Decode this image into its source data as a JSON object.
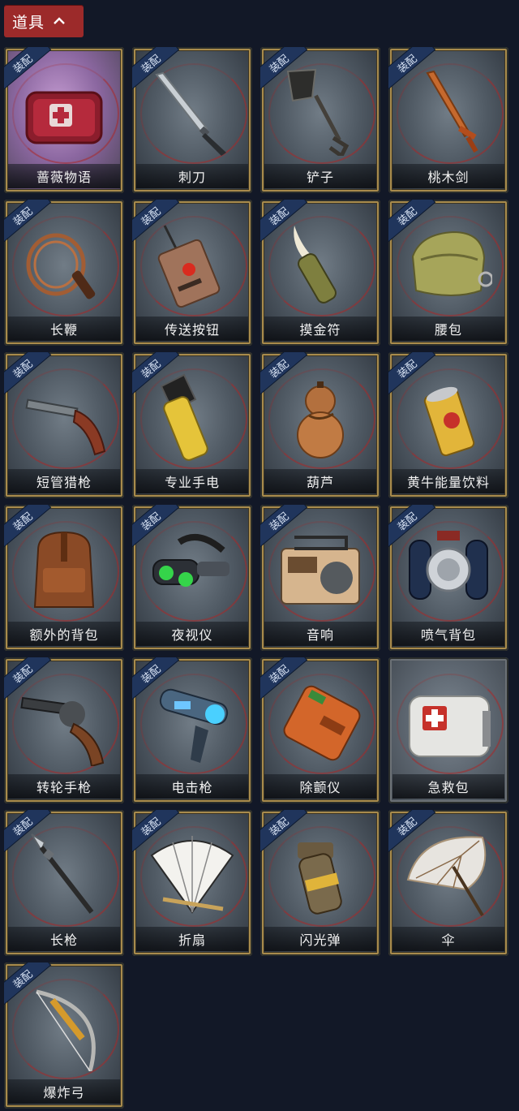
{
  "header": {
    "label": "道具"
  },
  "equip_badge": "装配",
  "items": [
    {
      "label": "蔷薇物语",
      "icon": "rose-tale-box-icon",
      "equipped": true
    },
    {
      "label": "刺刀",
      "icon": "bayonet-icon",
      "equipped": true
    },
    {
      "label": "铲子",
      "icon": "shovel-icon",
      "equipped": true
    },
    {
      "label": "桃木剑",
      "icon": "peachwood-sword-icon",
      "equipped": true
    },
    {
      "label": "长鞭",
      "icon": "whip-icon",
      "equipped": true
    },
    {
      "label": "传送按钮",
      "icon": "teleport-button-icon",
      "equipped": true
    },
    {
      "label": "摸金符",
      "icon": "tomb-charm-icon",
      "equipped": true
    },
    {
      "label": "腰包",
      "icon": "waist-bag-icon",
      "equipped": true
    },
    {
      "label": "短管猎枪",
      "icon": "sawed-off-shotgun-icon",
      "equipped": true
    },
    {
      "label": "专业手电",
      "icon": "flashlight-icon",
      "equipped": true
    },
    {
      "label": "葫芦",
      "icon": "gourd-icon",
      "equipped": true
    },
    {
      "label": "黄牛能量饮料",
      "icon": "energy-drink-icon",
      "equipped": true
    },
    {
      "label": "额外的背包",
      "icon": "backpack-icon",
      "equipped": true
    },
    {
      "label": "夜视仪",
      "icon": "night-vision-goggles-icon",
      "equipped": true
    },
    {
      "label": "音响",
      "icon": "radio-speaker-icon",
      "equipped": true
    },
    {
      "label": "喷气背包",
      "icon": "jetpack-icon",
      "equipped": true
    },
    {
      "label": "转轮手枪",
      "icon": "revolver-icon",
      "equipped": true
    },
    {
      "label": "电击枪",
      "icon": "stun-gun-icon",
      "equipped": true
    },
    {
      "label": "除颤仪",
      "icon": "defibrillator-icon",
      "equipped": true
    },
    {
      "label": "急救包",
      "icon": "first-aid-kit-icon",
      "equipped": false
    },
    {
      "label": "长枪",
      "icon": "spear-icon",
      "equipped": true
    },
    {
      "label": "折扇",
      "icon": "folding-fan-icon",
      "equipped": true
    },
    {
      "label": "闪光弹",
      "icon": "flashbang-icon",
      "equipped": true
    },
    {
      "label": "伞",
      "icon": "umbrella-icon",
      "equipped": true
    },
    {
      "label": "爆炸弓",
      "icon": "explosive-bow-icon",
      "equipped": true
    }
  ]
}
